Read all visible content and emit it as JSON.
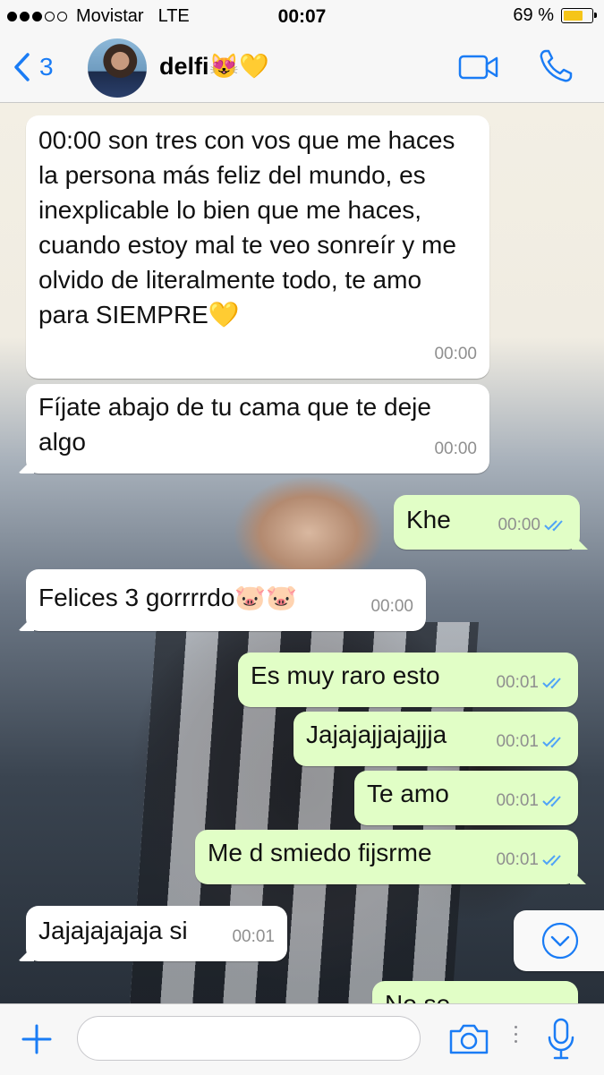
{
  "status_bar": {
    "carrier": "Movistar",
    "network": "LTE",
    "time": "00:07",
    "battery_percent": "69 %",
    "battery_level": 0.69,
    "battery_color": "#f5c518"
  },
  "nav": {
    "back_count": "3",
    "contact_name": "delfi😻💛",
    "accent_color": "#1a7cf5",
    "icons": [
      "chevron-left-icon",
      "video-call-icon",
      "phone-icon"
    ]
  },
  "messages": [
    {
      "direction": "in",
      "text": "00:00 son tres con vos que me haces la persona más feliz del mundo, es inexplicable lo bien que me haces, cuando estoy mal te veo sonreír y me olvido de literalmente todo, te amo para SIEMPRE💛",
      "time": "00:00"
    },
    {
      "direction": "in",
      "text": "Fíjate abajo de tu cama que te deje algo",
      "time": "00:00"
    },
    {
      "direction": "out",
      "text": "Khe",
      "time": "00:00",
      "status": "read"
    },
    {
      "direction": "in",
      "text": "Felices 3 gorrrrdo🐷🐷",
      "time": "00:00"
    },
    {
      "direction": "out",
      "text": "Es muy raro esto",
      "time": "00:01",
      "status": "read"
    },
    {
      "direction": "out",
      "text": "Jajajajjajajjja",
      "time": "00:01",
      "status": "read"
    },
    {
      "direction": "out",
      "text": "Te amo",
      "time": "00:01",
      "status": "read"
    },
    {
      "direction": "out",
      "text": "Me d smiedo fijsrme",
      "time": "00:01",
      "status": "read"
    },
    {
      "direction": "in",
      "text": "Jajajajajaja si",
      "time": "00:01"
    },
    {
      "direction": "out",
      "text": "No se",
      "time": "",
      "status": ""
    }
  ],
  "colors": {
    "incoming_bubble": "#ffffff",
    "outgoing_bubble": "#e1fec6",
    "read_ticks": "#4fa3f7",
    "timestamp": "#8f8f8f"
  },
  "input": {
    "message_placeholder": "",
    "icons": [
      "plus-icon",
      "camera-icon",
      "microphone-icon",
      "scroll-down-icon"
    ]
  }
}
